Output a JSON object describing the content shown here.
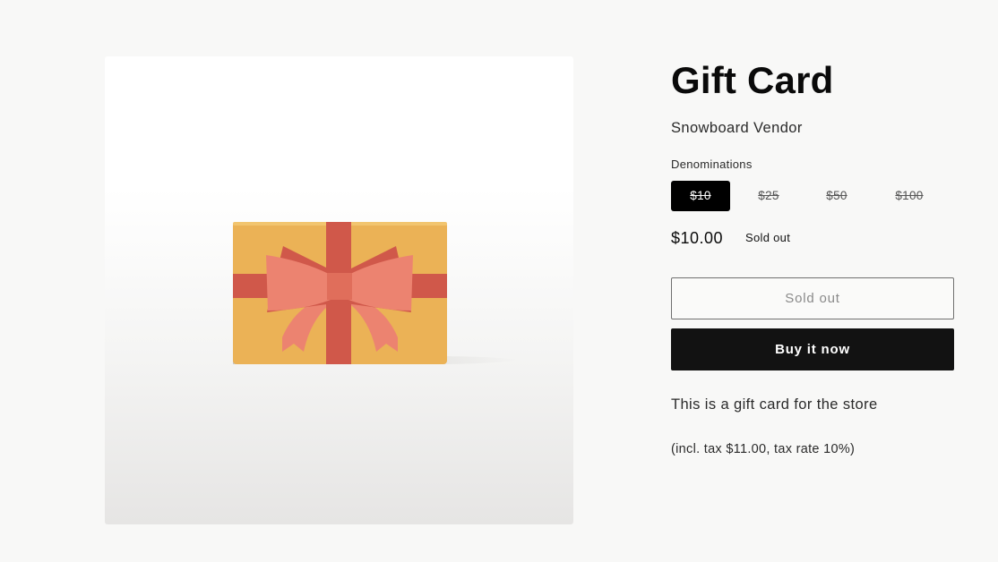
{
  "product": {
    "title": "Gift Card",
    "vendor": "Snowboard Vendor",
    "image_icon": "gift-card-image",
    "option_label": "Denominations",
    "denominations": [
      {
        "label": "$10",
        "selected": true,
        "available": false
      },
      {
        "label": "$25",
        "selected": false,
        "available": false
      },
      {
        "label": "$50",
        "selected": false,
        "available": false
      },
      {
        "label": "$100",
        "selected": false,
        "available": false
      }
    ],
    "price": "$10.00",
    "badge": "Sold out",
    "sold_out_button": "Sold out",
    "buy_now_button": "Buy it now",
    "description": "This is a gift card for the store",
    "tax_note": "(incl. tax $11.00, tax rate 10%)"
  },
  "colors": {
    "page_background": "#f8f8f7",
    "card_body": "#ebb256",
    "ribbon": "#d0584a",
    "bow": "#ec8370",
    "primary_button": "#121212",
    "selected_pill": "#000000"
  }
}
